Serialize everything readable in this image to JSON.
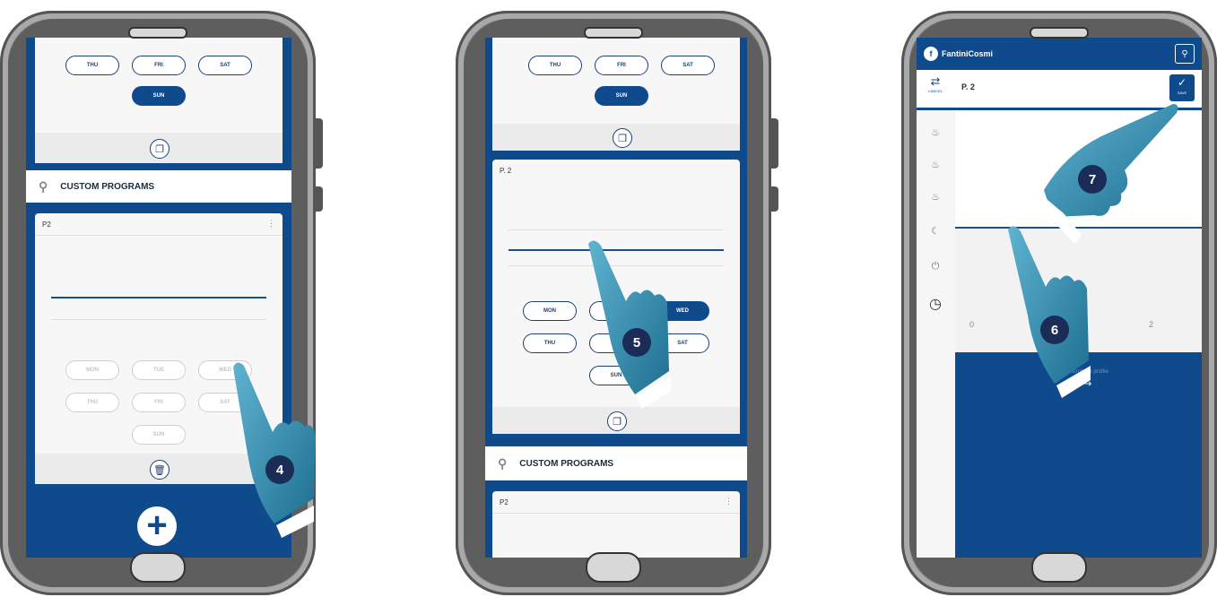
{
  "days": {
    "mon": "MON",
    "tue": "TUE",
    "wed": "WED",
    "thu": "THU",
    "fri": "FRI",
    "sat": "SAT",
    "sun": "SUN"
  },
  "section_title": "CUSTOM PROGRAMS",
  "phone1": {
    "program_name": "P2",
    "step": "4"
  },
  "phone2": {
    "program_name": "P. 2",
    "lower_program_name": "P2",
    "step": "5"
  },
  "phone3": {
    "brand": "FantiniCosmi",
    "program_name": "P. 2",
    "cancel_label": "CANCEL",
    "save_label": "SAVE",
    "axis_labels": [
      "0",
      "2"
    ],
    "hint": "Swipe to scroll the profile",
    "steps": [
      "6",
      "7"
    ]
  },
  "colors": {
    "primary": "#0e4a8c",
    "badge": "#1b2c57",
    "hand": "#3d98b8"
  }
}
